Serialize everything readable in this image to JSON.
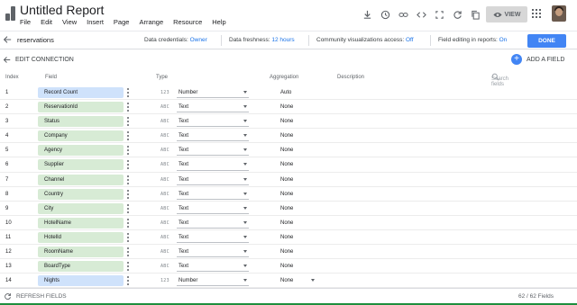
{
  "app": {
    "title": "Untitled Report",
    "menu": [
      "File",
      "Edit",
      "View",
      "Insert",
      "Page",
      "Arrange",
      "Resource",
      "Help"
    ],
    "toolbar_icons": [
      "download-icon",
      "history-icon",
      "link-icon",
      "code-icon",
      "fullscreen-icon",
      "refresh-icon",
      "copy-icon"
    ],
    "view_label": "VIEW"
  },
  "datasource": {
    "name": "reservations",
    "credentials_label": "Data credentials:",
    "credentials_value": "Owner",
    "freshness_label": "Data freshness:",
    "freshness_value": "12 hours",
    "community_label": "Community visualizations access:",
    "community_value": "Off",
    "editing_label": "Field editing in reports:",
    "editing_value": "On",
    "done_label": "DONE"
  },
  "edit": {
    "edit_connection_label": "EDIT CONNECTION",
    "add_field_label": "ADD A FIELD"
  },
  "table": {
    "headers": {
      "index": "Index",
      "field": "Field",
      "type": "Type",
      "aggregation": "Aggregation",
      "description": "Description"
    },
    "search_placeholder": "Search fields",
    "rows": [
      {
        "index": "1",
        "field": "Record Count",
        "glyph": "123",
        "type": "Number",
        "agg": "Auto",
        "metric": true
      },
      {
        "index": "2",
        "field": "ReservationId",
        "glyph": "ABC",
        "type": "Text",
        "agg": "None",
        "metric": false
      },
      {
        "index": "3",
        "field": "Status",
        "glyph": "ABC",
        "type": "Text",
        "agg": "None",
        "metric": false
      },
      {
        "index": "4",
        "field": "Company",
        "glyph": "ABC",
        "type": "Text",
        "agg": "None",
        "metric": false
      },
      {
        "index": "5",
        "field": "Agency",
        "glyph": "ABC",
        "type": "Text",
        "agg": "None",
        "metric": false
      },
      {
        "index": "6",
        "field": "Supplier",
        "glyph": "ABC",
        "type": "Text",
        "agg": "None",
        "metric": false
      },
      {
        "index": "7",
        "field": "Channel",
        "glyph": "ABC",
        "type": "Text",
        "agg": "None",
        "metric": false
      },
      {
        "index": "8",
        "field": "Country",
        "glyph": "ABC",
        "type": "Text",
        "agg": "None",
        "metric": false
      },
      {
        "index": "9",
        "field": "City",
        "glyph": "ABC",
        "type": "Text",
        "agg": "None",
        "metric": false
      },
      {
        "index": "10",
        "field": "HotelName",
        "glyph": "ABC",
        "type": "Text",
        "agg": "None",
        "metric": false
      },
      {
        "index": "11",
        "field": "HotelId",
        "glyph": "ABC",
        "type": "Text",
        "agg": "None",
        "metric": false
      },
      {
        "index": "12",
        "field": "RoomName",
        "glyph": "ABC",
        "type": "Text",
        "agg": "None",
        "metric": false
      },
      {
        "index": "13",
        "field": "BoardType",
        "glyph": "ABC",
        "type": "Text",
        "agg": "None",
        "metric": false
      },
      {
        "index": "14",
        "field": "Nights",
        "glyph": "123",
        "type": "Number",
        "agg": "None",
        "metric": true
      }
    ]
  },
  "footer": {
    "refresh_label": "REFRESH FIELDS",
    "count": "62 / 62 Fields"
  },
  "colors": {
    "accent": "#4285f4",
    "dimension_chip": "#d7ebd5",
    "metric_chip": "#cfe2fb"
  }
}
